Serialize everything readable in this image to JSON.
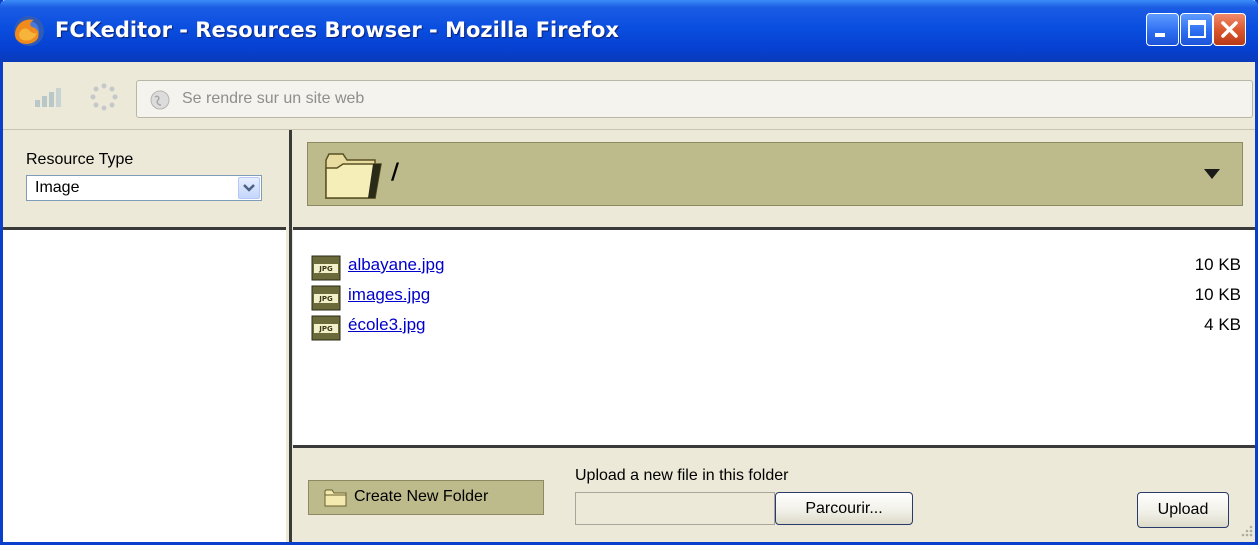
{
  "window": {
    "title": "FCKeditor - Resources Browser - Mozilla Firefox",
    "icons": [
      "firefox-icon",
      "minimize-icon",
      "maximize-icon",
      "close-icon"
    ]
  },
  "navbar": {
    "url_placeholder": "Se rendre sur un site web",
    "icons": [
      "signal-icon",
      "throbber-icon",
      "globe-icon"
    ]
  },
  "resource_type": {
    "label": "Resource Type",
    "selected": "Image",
    "options": [
      "Image"
    ]
  },
  "folder": {
    "path": "/",
    "icons": [
      "folder-open-icon",
      "dropdown-arrow-icon"
    ]
  },
  "files": [
    {
      "name": "albayane.jpg",
      "size": "10 KB",
      "icon": "jpg-file-icon"
    },
    {
      "name": "images.jpg",
      "size": "10 KB",
      "icon": "jpg-file-icon"
    },
    {
      "name": "école3.jpg",
      "size": "4 KB",
      "icon": "jpg-file-icon"
    }
  ],
  "footer": {
    "create_folder_label": "Create New Folder",
    "upload_label": "Upload a new file in this folder",
    "browse_label": "Parcourir...",
    "upload_button": "Upload",
    "file_value": ""
  },
  "colors": {
    "titlebar": "#0a4ee0",
    "chrome": "#ece9d8",
    "folderbar": "#bdbb8b",
    "link": "#0000cc"
  }
}
